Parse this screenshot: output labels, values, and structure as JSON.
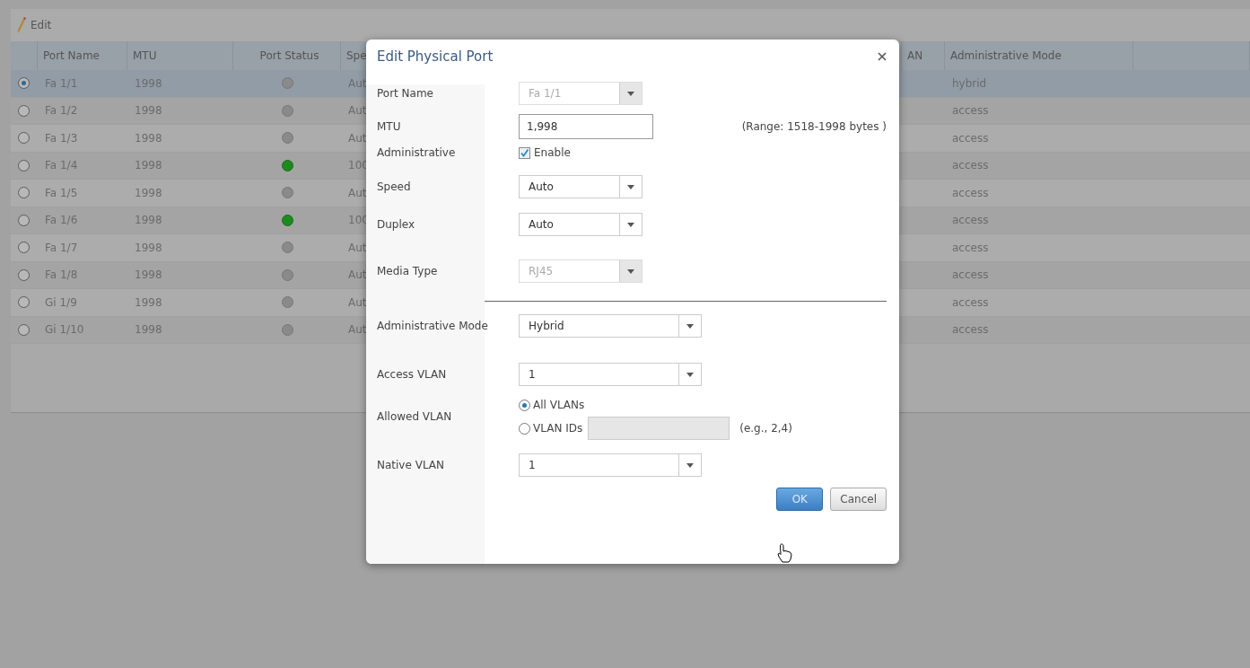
{
  "toolbar": {
    "edit_label": "Edit"
  },
  "table": {
    "columns": [
      "Port Name",
      "MTU",
      "Port Status",
      "Spe",
      "AN",
      "Administrative Mode"
    ],
    "rows": [
      {
        "selected": true,
        "port_name": "Fa 1/1",
        "mtu": "1998",
        "link_up": false,
        "speed": "Aut",
        "admin_mode": "hybrid"
      },
      {
        "selected": false,
        "port_name": "Fa 1/2",
        "mtu": "1998",
        "link_up": false,
        "speed": "Aut",
        "admin_mode": "access"
      },
      {
        "selected": false,
        "port_name": "Fa 1/3",
        "mtu": "1998",
        "link_up": false,
        "speed": "Aut",
        "admin_mode": "access"
      },
      {
        "selected": false,
        "port_name": "Fa 1/4",
        "mtu": "1998",
        "link_up": true,
        "speed": "100",
        "admin_mode": "access"
      },
      {
        "selected": false,
        "port_name": "Fa 1/5",
        "mtu": "1998",
        "link_up": false,
        "speed": "Aut",
        "admin_mode": "access"
      },
      {
        "selected": false,
        "port_name": "Fa 1/6",
        "mtu": "1998",
        "link_up": true,
        "speed": "100",
        "admin_mode": "access"
      },
      {
        "selected": false,
        "port_name": "Fa 1/7",
        "mtu": "1998",
        "link_up": false,
        "speed": "Aut",
        "admin_mode": "access"
      },
      {
        "selected": false,
        "port_name": "Fa 1/8",
        "mtu": "1998",
        "link_up": false,
        "speed": "Aut",
        "admin_mode": "access"
      },
      {
        "selected": false,
        "port_name": "Gi 1/9",
        "mtu": "1998",
        "link_up": false,
        "speed": "Aut",
        "admin_mode": "access"
      },
      {
        "selected": false,
        "port_name": "Gi 1/10",
        "mtu": "1998",
        "link_up": false,
        "speed": "Aut",
        "admin_mode": "access"
      }
    ]
  },
  "dialog": {
    "title": "Edit Physical Port",
    "port_settings": [
      {
        "kind": "select",
        "label": "Port Name",
        "value": "Fa 1/1",
        "disabled": true
      },
      {
        "kind": "input",
        "label": "MTU",
        "value": "1,998",
        "hint": "(Range: 1518-1998 bytes )"
      },
      {
        "kind": "checkbox",
        "label": "Administrative",
        "option": "Enable",
        "checked": true
      },
      {
        "kind": "select",
        "label": "Speed",
        "value": "Auto",
        "disabled": false
      },
      {
        "kind": "select",
        "label": "Duplex",
        "value": "Auto",
        "disabled": false
      },
      {
        "kind": "select",
        "label": "Media Type",
        "value": "RJ45",
        "disabled": true
      }
    ],
    "vlan_settings": [
      {
        "kind": "select",
        "label": "Administrative Mode",
        "value": "Hybrid",
        "disabled": false
      },
      {
        "kind": "select",
        "label": "Access VLAN",
        "value": "1",
        "disabled": false
      },
      {
        "kind": "radio_group",
        "label": "Allowed VLAN",
        "options": [
          {
            "label": "All VLANs",
            "selected": true
          },
          {
            "label": "VLAN IDs",
            "selected": false
          }
        ],
        "ids_field_disabled": true,
        "hint": "(e.g., 2,4)"
      },
      {
        "kind": "select",
        "label": "Native VLAN",
        "value": "1",
        "disabled": false
      }
    ],
    "buttons": [
      {
        "label": "OK",
        "primary": true
      },
      {
        "label": "Cancel",
        "primary": false
      }
    ]
  }
}
